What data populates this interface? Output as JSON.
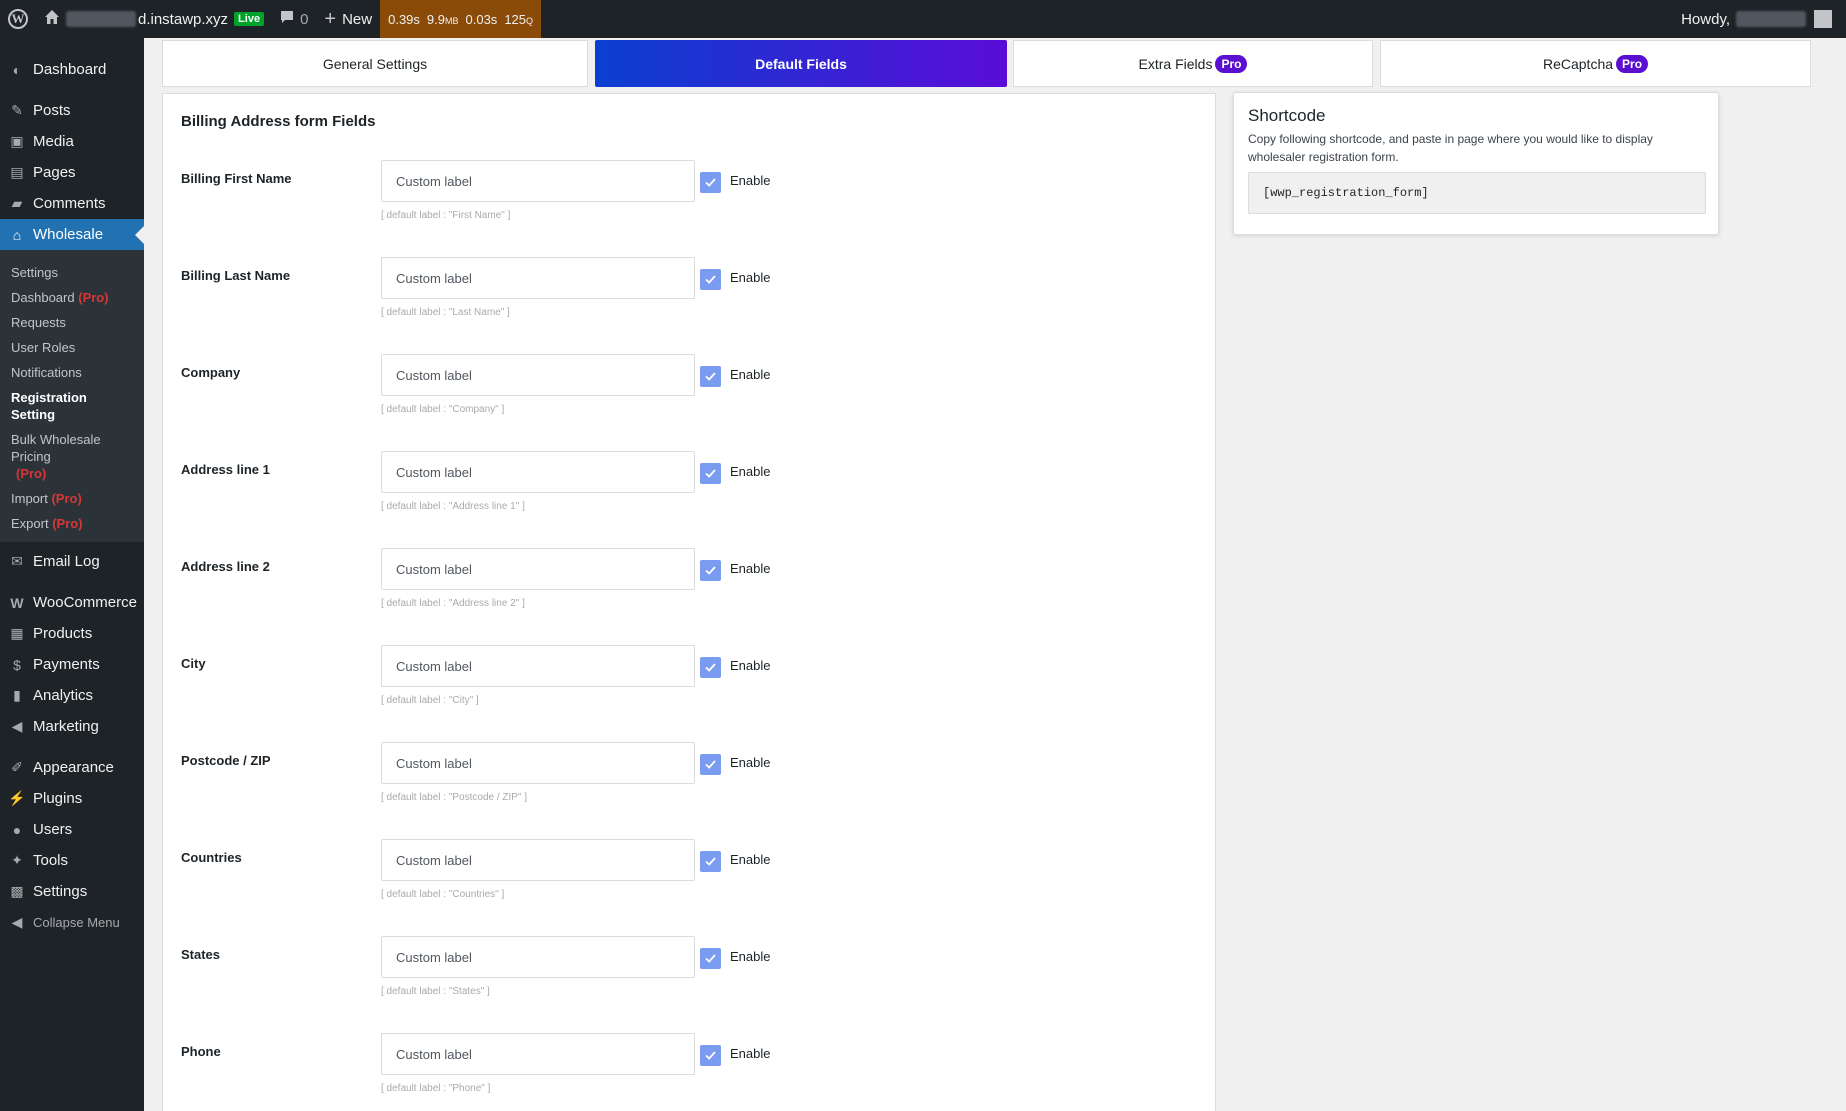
{
  "adminbar": {
    "site_name": "d.instawp.xyz",
    "live_badge": "Live",
    "comments_count": "0",
    "new_label": "New",
    "qm_time": "0.39s",
    "qm_memory": "9.9",
    "qm_memory_unit": "MB",
    "qm_db_time": "0.03s",
    "qm_queries": "125",
    "qm_queries_unit": "Q",
    "howdy": "Howdy,"
  },
  "sidebar": {
    "dashboard": "Dashboard",
    "posts": "Posts",
    "media": "Media",
    "pages": "Pages",
    "comments": "Comments",
    "wholesale": "Wholesale",
    "submenu": {
      "settings": "Settings",
      "dashboard": "Dashboard",
      "requests": "Requests",
      "user_roles": "User Roles",
      "notifications": "Notifications",
      "registration_setting": "Registration Setting",
      "bulk_pricing": "Bulk Wholesale Pricing",
      "import": "Import",
      "export": "Export",
      "pro_tag": "(Pro)"
    },
    "email_log": "Email Log",
    "woocommerce": "WooCommerce",
    "products": "Products",
    "payments": "Payments",
    "analytics": "Analytics",
    "marketing": "Marketing",
    "appearance": "Appearance",
    "plugins": "Plugins",
    "users": "Users",
    "tools": "Tools",
    "settings": "Settings",
    "collapse": "Collapse Menu"
  },
  "tabs": {
    "general": "General Settings",
    "default_fields": "Default Fields",
    "extra_fields": "Extra Fields",
    "recaptcha": "ReCaptcha",
    "pro_badge": "Pro"
  },
  "form": {
    "title": "Billing Address form Fields",
    "enable_label": "Enable",
    "fields": [
      {
        "label": "Billing First Name",
        "placeholder": "Custom label",
        "hint": "[ default label : \"First Name\" ]",
        "enabled": true
      },
      {
        "label": "Billing Last Name",
        "placeholder": "Custom label",
        "hint": "[ default label : \"Last Name\" ]",
        "enabled": true
      },
      {
        "label": "Company",
        "placeholder": "Custom label",
        "hint": "[ default label : \"Company\" ]",
        "enabled": true
      },
      {
        "label": "Address line 1",
        "placeholder": "Custom label",
        "hint": "[ default label : \"Address line 1\" ]",
        "enabled": true
      },
      {
        "label": "Address line 2",
        "placeholder": "Custom label",
        "hint": "[ default label : \"Address line 2\" ]",
        "enabled": true
      },
      {
        "label": "City",
        "placeholder": "Custom label",
        "hint": "[ default label : \"City\" ]",
        "enabled": true
      },
      {
        "label": "Postcode / ZIP",
        "placeholder": "Custom label",
        "hint": "[ default label : \"Postcode / ZIP\" ]",
        "enabled": true
      },
      {
        "label": "Countries",
        "placeholder": "Custom label",
        "hint": "[ default label : \"Countries\" ]",
        "enabled": true
      },
      {
        "label": "States",
        "placeholder": "Custom label",
        "hint": "[ default label : \"States\" ]",
        "enabled": true
      },
      {
        "label": "Phone",
        "placeholder": "Custom label",
        "hint": "[ default label : \"Phone\" ]",
        "enabled": true
      }
    ]
  },
  "shortcode": {
    "title": "Shortcode",
    "description": "Copy following shortcode, and paste in page where you would like to display wholesaler registration form.",
    "code": "[wwp_registration_form]"
  },
  "colors": {
    "accent": "#2271b1",
    "tab_gradient_start": "#0a3fd1",
    "tab_gradient_end": "#5a0cd6",
    "pro_badge": "#5b0fd0",
    "checkbox": "#7a9cf0",
    "pro_text": "#d63638"
  }
}
